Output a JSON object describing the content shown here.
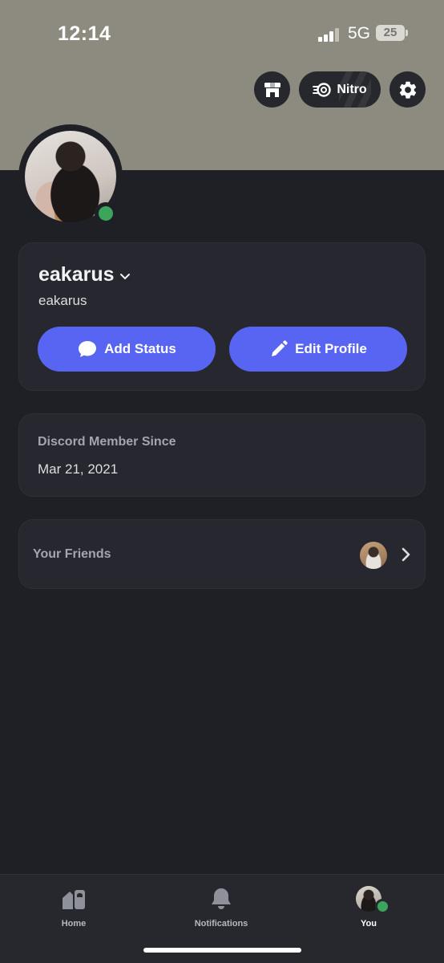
{
  "status_bar": {
    "time": "12:14",
    "network": "5G",
    "battery": "25"
  },
  "header": {
    "nitro_label": "Nitro",
    "shop_icon": "shop-icon",
    "settings_icon": "gear-icon"
  },
  "profile": {
    "display_name": "eakarus",
    "username": "eakarus",
    "online_status_color": "#3ba55c",
    "add_status_label": "Add Status",
    "edit_profile_label": "Edit Profile"
  },
  "member_since": {
    "heading": "Discord Member Since",
    "date": "Mar 21, 2021"
  },
  "friends": {
    "label": "Your Friends"
  },
  "tabs": [
    {
      "label": "Home",
      "icon": "home-icon"
    },
    {
      "label": "Notifications",
      "icon": "bell-icon"
    },
    {
      "label": "You",
      "icon": "avatar"
    }
  ],
  "colors": {
    "brand": "#5865f2",
    "banner": "#8d8a7f",
    "background": "#1f2025",
    "card": "#27282f"
  }
}
